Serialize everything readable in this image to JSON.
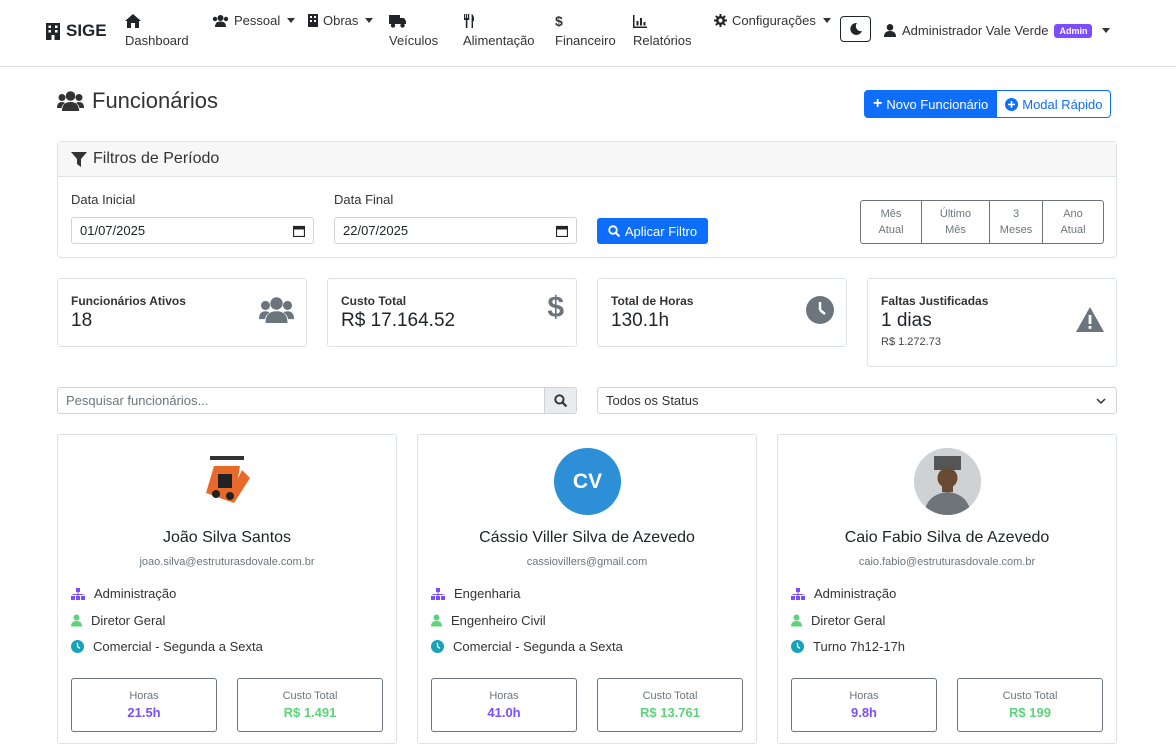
{
  "brand": {
    "name": "SIGE"
  },
  "nav": {
    "dashboard": "Dashboard",
    "pessoal": "Pessoal",
    "obras": "Obras",
    "veiculos": "Veículos",
    "alimentacao": "Alimentação",
    "financeiro": "Financeiro",
    "relatorios": "Relatórios",
    "configuracoes": "Configurações",
    "user_name": "Administrador Vale Verde",
    "user_badge": "Admin"
  },
  "page": {
    "title": "Funcionários",
    "new_button": "Novo Funcionário",
    "modal_button": "Modal Rápido"
  },
  "filters": {
    "title": "Filtros de Período",
    "start_label": "Data Inicial",
    "start_value": "01/07/2025",
    "end_label": "Data Final",
    "end_value": "22/07/2025",
    "apply": "Aplicar Filtro",
    "periods": [
      [
        "Mês",
        "Atual"
      ],
      [
        "Último",
        "Mês"
      ],
      [
        "3",
        "Meses"
      ],
      [
        "Ano",
        "Atual"
      ]
    ]
  },
  "stats": {
    "ativos": {
      "title": "Funcionários Ativos",
      "value": "18"
    },
    "custo": {
      "title": "Custo Total",
      "value": "R$ 17.164.52"
    },
    "horas": {
      "title": "Total de Horas",
      "value": "130.1h"
    },
    "faltas": {
      "title": "Faltas Justificadas",
      "value": "1 dias",
      "sub": "R$ 1.272.73"
    }
  },
  "search": {
    "placeholder": "Pesquisar funcionários...",
    "status": "Todos os Status"
  },
  "labels": {
    "horas": "Horas",
    "custo": "Custo Total"
  },
  "employees": [
    {
      "name": "João Silva Santos",
      "email": "joao.silva@estruturasdovale.com.br",
      "dept": "Administração",
      "role": "Diretor Geral",
      "shift": "Comercial - Segunda a Sexta",
      "hours": "21.5h",
      "cost": "R$ 1.491"
    },
    {
      "initials": "CV",
      "name": "Cássio Viller Silva de Azevedo",
      "email": "cassiovillers@gmail.com",
      "dept": "Engenharia",
      "role": "Engenheiro Civil",
      "shift": "Comercial - Segunda a Sexta",
      "hours": "41.0h",
      "cost": "R$ 13.761"
    },
    {
      "name": "Caio Fabio Silva de Azevedo",
      "email": "caio.fabio@estruturasdovale.com.br",
      "dept": "Administração",
      "role": "Diretor Geral",
      "shift": "Turno 7h12-17h",
      "hours": "9.8h",
      "cost": "R$ 199"
    }
  ],
  "colors": {
    "primary": "#0d6efd",
    "hours": "#7c4dff",
    "cost": "#5cd47a",
    "dept_icon": "#7c4dff",
    "role_icon": "#5cd47a",
    "shift_icon": "#17a2b8"
  }
}
